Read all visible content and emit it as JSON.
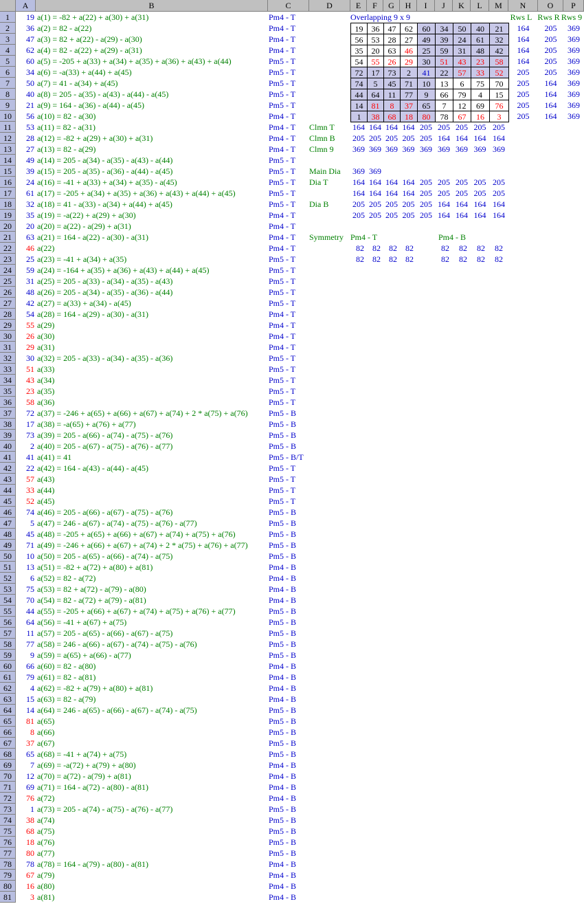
{
  "col_headers": [
    "A",
    "B",
    "C",
    "D",
    "E",
    "F",
    "G",
    "H",
    "I",
    "J",
    "K",
    "L",
    "M",
    "N",
    "O",
    "P"
  ],
  "rows": [
    {
      "n": "1",
      "a": "19",
      "ac": "blue",
      "b": "a(1) = -82 + a(22) + a(30) + a(31)",
      "bc": "green",
      "c": "Pm4 - T"
    },
    {
      "n": "2",
      "a": "36",
      "ac": "blue",
      "b": "a(2) = 82 - a(22)",
      "bc": "green",
      "c": "Pm4 - T"
    },
    {
      "n": "3",
      "a": "47",
      "ac": "blue",
      "b": "a(3) = 82 + a(22) - a(29) - a(30)",
      "bc": "green",
      "c": "Pm4 - T"
    },
    {
      "n": "4",
      "a": "62",
      "ac": "blue",
      "b": "a(4) = 82 - a(22) + a(29) - a(31)",
      "bc": "green",
      "c": "Pm4 - T"
    },
    {
      "n": "5",
      "a": "60",
      "ac": "blue",
      "b": "a(5) = -205 + a(33) + a(34) + a(35) + a(36) + a(43) + a(44)",
      "bc": "green",
      "c": "Pm5 - T"
    },
    {
      "n": "6",
      "a": "34",
      "ac": "blue",
      "b": "a(6) = -a(33) + a(44) + a(45)",
      "bc": "green",
      "c": "Pm5 - T"
    },
    {
      "n": "7",
      "a": "50",
      "ac": "blue",
      "b": "a(7) = 41 - a(34) + a(45)",
      "bc": "green",
      "c": "Pm5 - T"
    },
    {
      "n": "8",
      "a": "40",
      "ac": "blue",
      "b": "a(8) = 205 - a(35) - a(43) - a(44) - a(45)",
      "bc": "green",
      "c": "Pm5 - T"
    },
    {
      "n": "9",
      "a": "21",
      "ac": "blue",
      "b": "a(9) = 164 - a(36) - a(44) - a(45)",
      "bc": "green",
      "c": "Pm5 - T"
    },
    {
      "n": "10",
      "a": "56",
      "ac": "blue",
      "b": "a(10) = 82 - a(30)",
      "bc": "green",
      "c": "Pm4 - T"
    },
    {
      "n": "11",
      "a": "53",
      "ac": "blue",
      "b": "a(11) = 82 - a(31)",
      "bc": "green",
      "c": "Pm4 - T"
    },
    {
      "n": "12",
      "a": "28",
      "ac": "blue",
      "b": "a(12) = -82 + a(29) + a(30) + a(31)",
      "bc": "green",
      "c": "Pm4 - T"
    },
    {
      "n": "13",
      "a": "27",
      "ac": "blue",
      "b": "a(13) = 82 - a(29)",
      "bc": "green",
      "c": "Pm4 - T"
    },
    {
      "n": "14",
      "a": "49",
      "ac": "blue",
      "b": "a(14) = 205 - a(34) - a(35) - a(43) - a(44)",
      "bc": "green",
      "c": "Pm5 - T"
    },
    {
      "n": "15",
      "a": "39",
      "ac": "blue",
      "b": "a(15) = 205 - a(35) - a(36) - a(44) - a(45)",
      "bc": "green",
      "c": "Pm5 - T"
    },
    {
      "n": "16",
      "a": "24",
      "ac": "blue",
      "b": "a(16) = -41 + a(33) + a(34) + a(35) - a(45)",
      "bc": "green",
      "c": "Pm5 - T"
    },
    {
      "n": "17",
      "a": "61",
      "ac": "blue",
      "b": "a(17) = -205 + a(34) + a(35) + a(36) + a(43) + a(44) + a(45)",
      "bc": "green",
      "c": "Pm5 - T"
    },
    {
      "n": "18",
      "a": "32",
      "ac": "blue",
      "b": "a(18) = 41 - a(33) - a(34) + a(44) + a(45)",
      "bc": "green",
      "c": "Pm5 - T"
    },
    {
      "n": "19",
      "a": "35",
      "ac": "blue",
      "b": "a(19) = -a(22) + a(29) + a(30)",
      "bc": "green",
      "c": "Pm4 - T"
    },
    {
      "n": "20",
      "a": "20",
      "ac": "blue",
      "b": "a(20) = a(22) - a(29) + a(31)",
      "bc": "green",
      "c": "Pm4 - T"
    },
    {
      "n": "21",
      "a": "63",
      "ac": "blue",
      "b": "a(21) = 164 - a(22) - a(30) - a(31)",
      "bc": "green",
      "c": "Pm4 - T"
    },
    {
      "n": "22",
      "a": "46",
      "ac": "red",
      "b": "a(22)",
      "bc": "green",
      "c": "Pm4 - T"
    },
    {
      "n": "23",
      "a": "25",
      "ac": "blue",
      "b": "a(23) = -41 + a(34) + a(35)",
      "bc": "green",
      "c": "Pm5 - T"
    },
    {
      "n": "24",
      "a": "59",
      "ac": "blue",
      "b": "a(24) = -164 + a(35) + a(36) + a(43) + a(44) + a(45)",
      "bc": "green",
      "c": "Pm5 - T"
    },
    {
      "n": "25",
      "a": "31",
      "ac": "blue",
      "b": "a(25) = 205 - a(33) - a(34) - a(35) - a(43)",
      "bc": "green",
      "c": "Pm5 - T"
    },
    {
      "n": "26",
      "a": "48",
      "ac": "blue",
      "b": "a(26) = 205 - a(34) - a(35) - a(36) - a(44)",
      "bc": "green",
      "c": "Pm5 - T"
    },
    {
      "n": "27",
      "a": "42",
      "ac": "blue",
      "b": "a(27) = a(33) + a(34) - a(45)",
      "bc": "green",
      "c": "Pm5 - T"
    },
    {
      "n": "28",
      "a": "54",
      "ac": "blue",
      "b": "a(28) = 164 - a(29) - a(30) - a(31)",
      "bc": "green",
      "c": "Pm4 - T"
    },
    {
      "n": "29",
      "a": "55",
      "ac": "red",
      "b": "a(29)",
      "bc": "green",
      "c": "Pm4 - T"
    },
    {
      "n": "30",
      "a": "26",
      "ac": "red",
      "b": "a(30)",
      "bc": "green",
      "c": "Pm4 - T"
    },
    {
      "n": "31",
      "a": "29",
      "ac": "red",
      "b": "a(31)",
      "bc": "green",
      "c": "Pm4 - T"
    },
    {
      "n": "32",
      "a": "30",
      "ac": "blue",
      "b": "a(32) = 205 - a(33) - a(34) - a(35) - a(36)",
      "bc": "green",
      "c": "Pm5 - T"
    },
    {
      "n": "33",
      "a": "51",
      "ac": "red",
      "b": "a(33)",
      "bc": "green",
      "c": "Pm5 - T"
    },
    {
      "n": "34",
      "a": "43",
      "ac": "red",
      "b": "a(34)",
      "bc": "green",
      "c": "Pm5 - T"
    },
    {
      "n": "35",
      "a": "23",
      "ac": "red",
      "b": "a(35)",
      "bc": "green",
      "c": "Pm5 - T"
    },
    {
      "n": "36",
      "a": "58",
      "ac": "red",
      "b": "a(36)",
      "bc": "green",
      "c": "Pm5 - T"
    },
    {
      "n": "37",
      "a": "72",
      "ac": "blue",
      "b": "a(37) = -246 + a(65) + a(66) + a(67) + a(74) + 2 * a(75) + a(76)",
      "bc": "green",
      "c": "Pm5 - B"
    },
    {
      "n": "38",
      "a": "17",
      "ac": "blue",
      "b": "a(38) = -a(65) + a(76) + a(77)",
      "bc": "green",
      "c": "Pm5 - B"
    },
    {
      "n": "39",
      "a": "73",
      "ac": "blue",
      "b": "a(39) = 205 - a(66) - a(74) - a(75) - a(76)",
      "bc": "green",
      "c": "Pm5 - B"
    },
    {
      "n": "40",
      "a": "2",
      "ac": "blue",
      "b": "a(40) = 205 - a(67) - a(75) - a(76) - a(77)",
      "bc": "green",
      "c": "Pm5 - B"
    },
    {
      "n": "41",
      "a": "41",
      "ac": "blue",
      "b": "a(41) = 41",
      "bc": "green",
      "c": "Pm5 - B/T"
    },
    {
      "n": "42",
      "a": "22",
      "ac": "blue",
      "b": "a(42) = 164 - a(43) - a(44) - a(45)",
      "bc": "green",
      "c": "Pm5 - T"
    },
    {
      "n": "43",
      "a": "57",
      "ac": "red",
      "b": "a(43)",
      "bc": "green",
      "c": "Pm5 - T"
    },
    {
      "n": "44",
      "a": "33",
      "ac": "red",
      "b": "a(44)",
      "bc": "green",
      "c": "Pm5 - T"
    },
    {
      "n": "45",
      "a": "52",
      "ac": "red",
      "b": "a(45)",
      "bc": "green",
      "c": "Pm5 - T"
    },
    {
      "n": "46",
      "a": "74",
      "ac": "blue",
      "b": "a(46) = 205 - a(66) - a(67) - a(75) - a(76)",
      "bc": "green",
      "c": "Pm5 - B"
    },
    {
      "n": "47",
      "a": "5",
      "ac": "blue",
      "b": "a(47) = 246 - a(67) - a(74) - a(75) - a(76) - a(77)",
      "bc": "green",
      "c": "Pm5 - B"
    },
    {
      "n": "48",
      "a": "45",
      "ac": "blue",
      "b": "a(48) = -205 + a(65) + a(66) + a(67) + a(74) + a(75) + a(76)",
      "bc": "green",
      "c": "Pm5 - B"
    },
    {
      "n": "49",
      "a": "71",
      "ac": "blue",
      "b": "a(49) = -246 + a(66) + a(67) + a(74) + 2 * a(75) + a(76) + a(77)",
      "bc": "green",
      "c": "Pm5 - B"
    },
    {
      "n": "50",
      "a": "10",
      "ac": "blue",
      "b": "a(50) = 205 - a(65) - a(66) - a(74) - a(75)",
      "bc": "green",
      "c": "Pm5 - B"
    },
    {
      "n": "51",
      "a": "13",
      "ac": "blue",
      "b": "a(51) = -82 + a(72) + a(80) + a(81)",
      "bc": "green",
      "c": "Pm4 - B"
    },
    {
      "n": "52",
      "a": "6",
      "ac": "blue",
      "b": "a(52) = 82 - a(72)",
      "bc": "green",
      "c": "Pm4 - B"
    },
    {
      "n": "53",
      "a": "75",
      "ac": "blue",
      "b": "a(53) = 82 + a(72) - a(79) - a(80)",
      "bc": "green",
      "c": "Pm4 - B"
    },
    {
      "n": "54",
      "a": "70",
      "ac": "blue",
      "b": "a(54) = 82 - a(72) + a(79) - a(81)",
      "bc": "green",
      "c": "Pm4 - B"
    },
    {
      "n": "55",
      "a": "44",
      "ac": "blue",
      "b": "a(55) = -205 + a(66) + a(67) + a(74) + a(75) + a(76) + a(77)",
      "bc": "green",
      "c": "Pm5 - B"
    },
    {
      "n": "56",
      "a": "64",
      "ac": "blue",
      "b": "a(56) = -41 + a(67) + a(75)",
      "bc": "green",
      "c": "Pm5 - B"
    },
    {
      "n": "57",
      "a": "11",
      "ac": "blue",
      "b": "a(57) = 205 - a(65) - a(66) - a(67) - a(75)",
      "bc": "green",
      "c": "Pm5 - B"
    },
    {
      "n": "58",
      "a": "77",
      "ac": "blue",
      "b": "a(58) = 246 - a(66) - a(67) - a(74) - a(75) - a(76)",
      "bc": "green",
      "c": "Pm5 - B"
    },
    {
      "n": "59",
      "a": "9",
      "ac": "blue",
      "b": "a(59) = a(65) + a(66) - a(77)",
      "bc": "green",
      "c": "Pm5 - B"
    },
    {
      "n": "60",
      "a": "66",
      "ac": "blue",
      "b": "a(60) = 82 - a(80)",
      "bc": "green",
      "c": "Pm4 - B"
    },
    {
      "n": "61",
      "a": "79",
      "ac": "blue",
      "b": "a(61) = 82 - a(81)",
      "bc": "green",
      "c": "Pm4 - B"
    },
    {
      "n": "62",
      "a": "4",
      "ac": "blue",
      "b": "a(62) = -82 + a(79) + a(80) + a(81)",
      "bc": "green",
      "c": "Pm4 - B"
    },
    {
      "n": "63",
      "a": "15",
      "ac": "blue",
      "b": "a(63) = 82 - a(79)",
      "bc": "green",
      "c": "Pm4 - B"
    },
    {
      "n": "64",
      "a": "14",
      "ac": "blue",
      "b": "a(64) = 246 - a(65) - a(66) - a(67) - a(74) - a(75)",
      "bc": "green",
      "c": "Pm5 - B"
    },
    {
      "n": "65",
      "a": "81",
      "ac": "red",
      "b": "a(65)",
      "bc": "green",
      "c": "Pm5 - B"
    },
    {
      "n": "66",
      "a": "8",
      "ac": "red",
      "b": "a(66)",
      "bc": "green",
      "c": "Pm5 - B"
    },
    {
      "n": "67",
      "a": "37",
      "ac": "red",
      "b": "a(67)",
      "bc": "green",
      "c": "Pm5 - B"
    },
    {
      "n": "68",
      "a": "65",
      "ac": "blue",
      "b": "a(68) = -41 + a(74) + a(75)",
      "bc": "green",
      "c": "Pm5 - B"
    },
    {
      "n": "69",
      "a": "7",
      "ac": "blue",
      "b": "a(69) = -a(72) + a(79) + a(80)",
      "bc": "green",
      "c": "Pm4 - B"
    },
    {
      "n": "70",
      "a": "12",
      "ac": "blue",
      "b": "a(70) = a(72) - a(79) + a(81)",
      "bc": "green",
      "c": "Pm4 - B"
    },
    {
      "n": "71",
      "a": "69",
      "ac": "blue",
      "b": "a(71) = 164 - a(72) - a(80) - a(81)",
      "bc": "green",
      "c": "Pm4 - B"
    },
    {
      "n": "72",
      "a": "76",
      "ac": "red",
      "b": "a(72)",
      "bc": "green",
      "c": "Pm4 - B"
    },
    {
      "n": "73",
      "a": "1",
      "ac": "blue",
      "b": "a(73) = 205 - a(74) - a(75) - a(76) - a(77)",
      "bc": "green",
      "c": "Pm5 - B"
    },
    {
      "n": "74",
      "a": "38",
      "ac": "red",
      "b": "a(74)",
      "bc": "green",
      "c": "Pm5 - B"
    },
    {
      "n": "75",
      "a": "68",
      "ac": "red",
      "b": "a(75)",
      "bc": "green",
      "c": "Pm5 - B"
    },
    {
      "n": "76",
      "a": "18",
      "ac": "red",
      "b": "a(76)",
      "bc": "green",
      "c": "Pm5 - B"
    },
    {
      "n": "77",
      "a": "80",
      "ac": "red",
      "b": "a(77)",
      "bc": "green",
      "c": "Pm5 - B"
    },
    {
      "n": "78",
      "a": "78",
      "ac": "blue",
      "b": "a(78) = 164 - a(79) - a(80) - a(81)",
      "bc": "green",
      "c": "Pm4 - B"
    },
    {
      "n": "79",
      "a": "67",
      "ac": "red",
      "b": "a(79)",
      "bc": "green",
      "c": "Pm4 - B"
    },
    {
      "n": "80",
      "a": "16",
      "ac": "red",
      "b": "a(80)",
      "bc": "green",
      "c": "Pm4 - B"
    },
    {
      "n": "81",
      "a": "3",
      "ac": "red",
      "b": "a(81)",
      "bc": "green",
      "c": "Pm4 - B"
    }
  ],
  "square_title": "Overlapping 9 x 9",
  "square": [
    [
      {
        "v": "19",
        "k": "b"
      },
      {
        "v": "36",
        "k": "b"
      },
      {
        "v": "47",
        "k": "b"
      },
      {
        "v": "62",
        "k": "b"
      },
      {
        "v": "60",
        "k": "bs"
      },
      {
        "v": "34",
        "k": "bs"
      },
      {
        "v": "50",
        "k": "bs"
      },
      {
        "v": "40",
        "k": "bs"
      },
      {
        "v": "21",
        "k": "bs"
      }
    ],
    [
      {
        "v": "56",
        "k": "b"
      },
      {
        "v": "53",
        "k": "b"
      },
      {
        "v": "28",
        "k": "b"
      },
      {
        "v": "27",
        "k": "b"
      },
      {
        "v": "49",
        "k": "bs"
      },
      {
        "v": "39",
        "k": "bs"
      },
      {
        "v": "24",
        "k": "bs"
      },
      {
        "v": "61",
        "k": "bs"
      },
      {
        "v": "32",
        "k": "bs"
      }
    ],
    [
      {
        "v": "35",
        "k": "b"
      },
      {
        "v": "20",
        "k": "b"
      },
      {
        "v": "63",
        "k": "b"
      },
      {
        "v": "46",
        "k": "r"
      },
      {
        "v": "25",
        "k": "bs"
      },
      {
        "v": "59",
        "k": "bs"
      },
      {
        "v": "31",
        "k": "bs"
      },
      {
        "v": "48",
        "k": "bs"
      },
      {
        "v": "42",
        "k": "bs"
      }
    ],
    [
      {
        "v": "54",
        "k": "b"
      },
      {
        "v": "55",
        "k": "r"
      },
      {
        "v": "26",
        "k": "r"
      },
      {
        "v": "29",
        "k": "r"
      },
      {
        "v": "30",
        "k": "bs"
      },
      {
        "v": "51",
        "k": "rs"
      },
      {
        "v": "43",
        "k": "rs"
      },
      {
        "v": "23",
        "k": "rs"
      },
      {
        "v": "58",
        "k": "rs"
      }
    ],
    [
      {
        "v": "72",
        "k": "bs"
      },
      {
        "v": "17",
        "k": "bs"
      },
      {
        "v": "73",
        "k": "bs"
      },
      {
        "v": "2",
        "k": "bs"
      },
      {
        "v": "41",
        "k": "blue_s"
      },
      {
        "v": "22",
        "k": "bs"
      },
      {
        "v": "57",
        "k": "rs"
      },
      {
        "v": "33",
        "k": "rs"
      },
      {
        "v": "52",
        "k": "rs"
      }
    ],
    [
      {
        "v": "74",
        "k": "bs"
      },
      {
        "v": "5",
        "k": "bs"
      },
      {
        "v": "45",
        "k": "bs"
      },
      {
        "v": "71",
        "k": "bs"
      },
      {
        "v": "10",
        "k": "bs"
      },
      {
        "v": "13",
        "k": "b"
      },
      {
        "v": "6",
        "k": "b"
      },
      {
        "v": "75",
        "k": "b"
      },
      {
        "v": "70",
        "k": "b"
      }
    ],
    [
      {
        "v": "44",
        "k": "bs"
      },
      {
        "v": "64",
        "k": "bs"
      },
      {
        "v": "11",
        "k": "bs"
      },
      {
        "v": "77",
        "k": "bs"
      },
      {
        "v": "9",
        "k": "bs"
      },
      {
        "v": "66",
        "k": "b"
      },
      {
        "v": "79",
        "k": "b"
      },
      {
        "v": "4",
        "k": "b"
      },
      {
        "v": "15",
        "k": "b"
      }
    ],
    [
      {
        "v": "14",
        "k": "bs"
      },
      {
        "v": "81",
        "k": "rs"
      },
      {
        "v": "8",
        "k": "rs"
      },
      {
        "v": "37",
        "k": "rs"
      },
      {
        "v": "65",
        "k": "bs"
      },
      {
        "v": "7",
        "k": "b"
      },
      {
        "v": "12",
        "k": "b"
      },
      {
        "v": "69",
        "k": "b"
      },
      {
        "v": "76",
        "k": "r"
      }
    ],
    [
      {
        "v": "1",
        "k": "bs"
      },
      {
        "v": "38",
        "k": "rs"
      },
      {
        "v": "68",
        "k": "rs"
      },
      {
        "v": "18",
        "k": "rs"
      },
      {
        "v": "80",
        "k": "rs"
      },
      {
        "v": "78",
        "k": "b"
      },
      {
        "v": "67",
        "k": "r"
      },
      {
        "v": "16",
        "k": "r"
      },
      {
        "v": "3",
        "k": "r"
      }
    ]
  ],
  "row_sum_headers": [
    "Rws L",
    "Rws R",
    "Rws 9"
  ],
  "row_sums": [
    [
      "164",
      "205",
      "369"
    ],
    [
      "164",
      "205",
      "369"
    ],
    [
      "164",
      "205",
      "369"
    ],
    [
      "164",
      "205",
      "369"
    ],
    [
      "205",
      "205",
      "369"
    ],
    [
      "205",
      "164",
      "369"
    ],
    [
      "205",
      "164",
      "369"
    ],
    [
      "205",
      "164",
      "369"
    ],
    [
      "205",
      "164",
      "369"
    ]
  ],
  "col_sums": [
    {
      "label": "Clmn T",
      "values": [
        "164",
        "164",
        "164",
        "164",
        "205",
        "205",
        "205",
        "205",
        "205"
      ]
    },
    {
      "label": "Clmn B",
      "values": [
        "205",
        "205",
        "205",
        "205",
        "205",
        "164",
        "164",
        "164",
        "164"
      ]
    },
    {
      "label": "Clmn 9",
      "values": [
        "369",
        "369",
        "369",
        "369",
        "369",
        "369",
        "369",
        "369",
        "369"
      ]
    }
  ],
  "main_dia": {
    "label": "Main Dia",
    "values": [
      "369",
      "369"
    ]
  },
  "dia_t": {
    "label": "Dia T",
    "rows": [
      [
        "164",
        "164",
        "164",
        "164",
        "205",
        "205",
        "205",
        "205",
        "205"
      ],
      [
        "164",
        "164",
        "164",
        "164",
        "205",
        "205",
        "205",
        "205",
        "205"
      ]
    ]
  },
  "dia_b": {
    "label": "Dia B",
    "rows": [
      [
        "205",
        "205",
        "205",
        "205",
        "205",
        "164",
        "164",
        "164",
        "164"
      ],
      [
        "205",
        "205",
        "205",
        "205",
        "205",
        "164",
        "164",
        "164",
        "164"
      ]
    ]
  },
  "symmetry": {
    "label": "Symmetry",
    "t_label": "Pm4 - T",
    "b_label": "Pm4 - B",
    "t_rows": [
      [
        "82",
        "82",
        "82",
        "82"
      ],
      [
        "82",
        "82",
        "82",
        "82"
      ]
    ],
    "b_rows": [
      [
        "82",
        "82",
        "82",
        "82"
      ],
      [
        "82",
        "82",
        "82",
        "82"
      ]
    ]
  },
  "colors": {
    "blue": "#0000cc",
    "green": "#008000",
    "red": "#ff0000",
    "header_gray": "#c0c0c0",
    "header_sel": "#b8bee0",
    "shade": "#c8c8e8"
  }
}
